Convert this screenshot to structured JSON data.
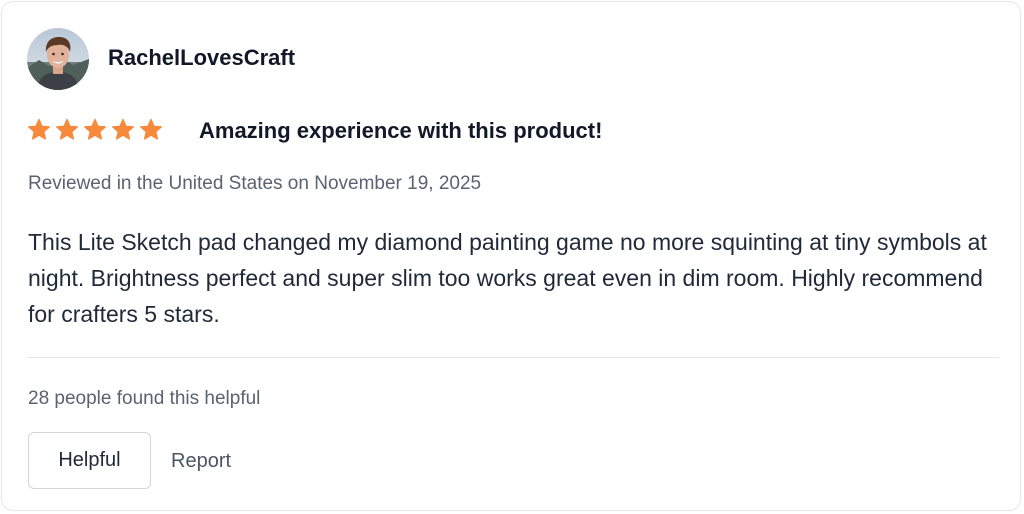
{
  "review": {
    "username": "RachelLovesCraft",
    "rating": 5,
    "rating_max": 5,
    "star_color": "#f6893b",
    "title": "Amazing experience with this product!",
    "meta": "Reviewed in the United States on November 19, 2025",
    "body": "This Lite Sketch pad changed my diamond painting game no more squinting at tiny symbols at night. Brightness perfect and super slim too works great even in dim room. Highly recommend for crafters 5 stars."
  },
  "feedback": {
    "helpful_count_text": "28 people found this helpful",
    "helpful_button_label": "Helpful",
    "report_label": "Report"
  }
}
